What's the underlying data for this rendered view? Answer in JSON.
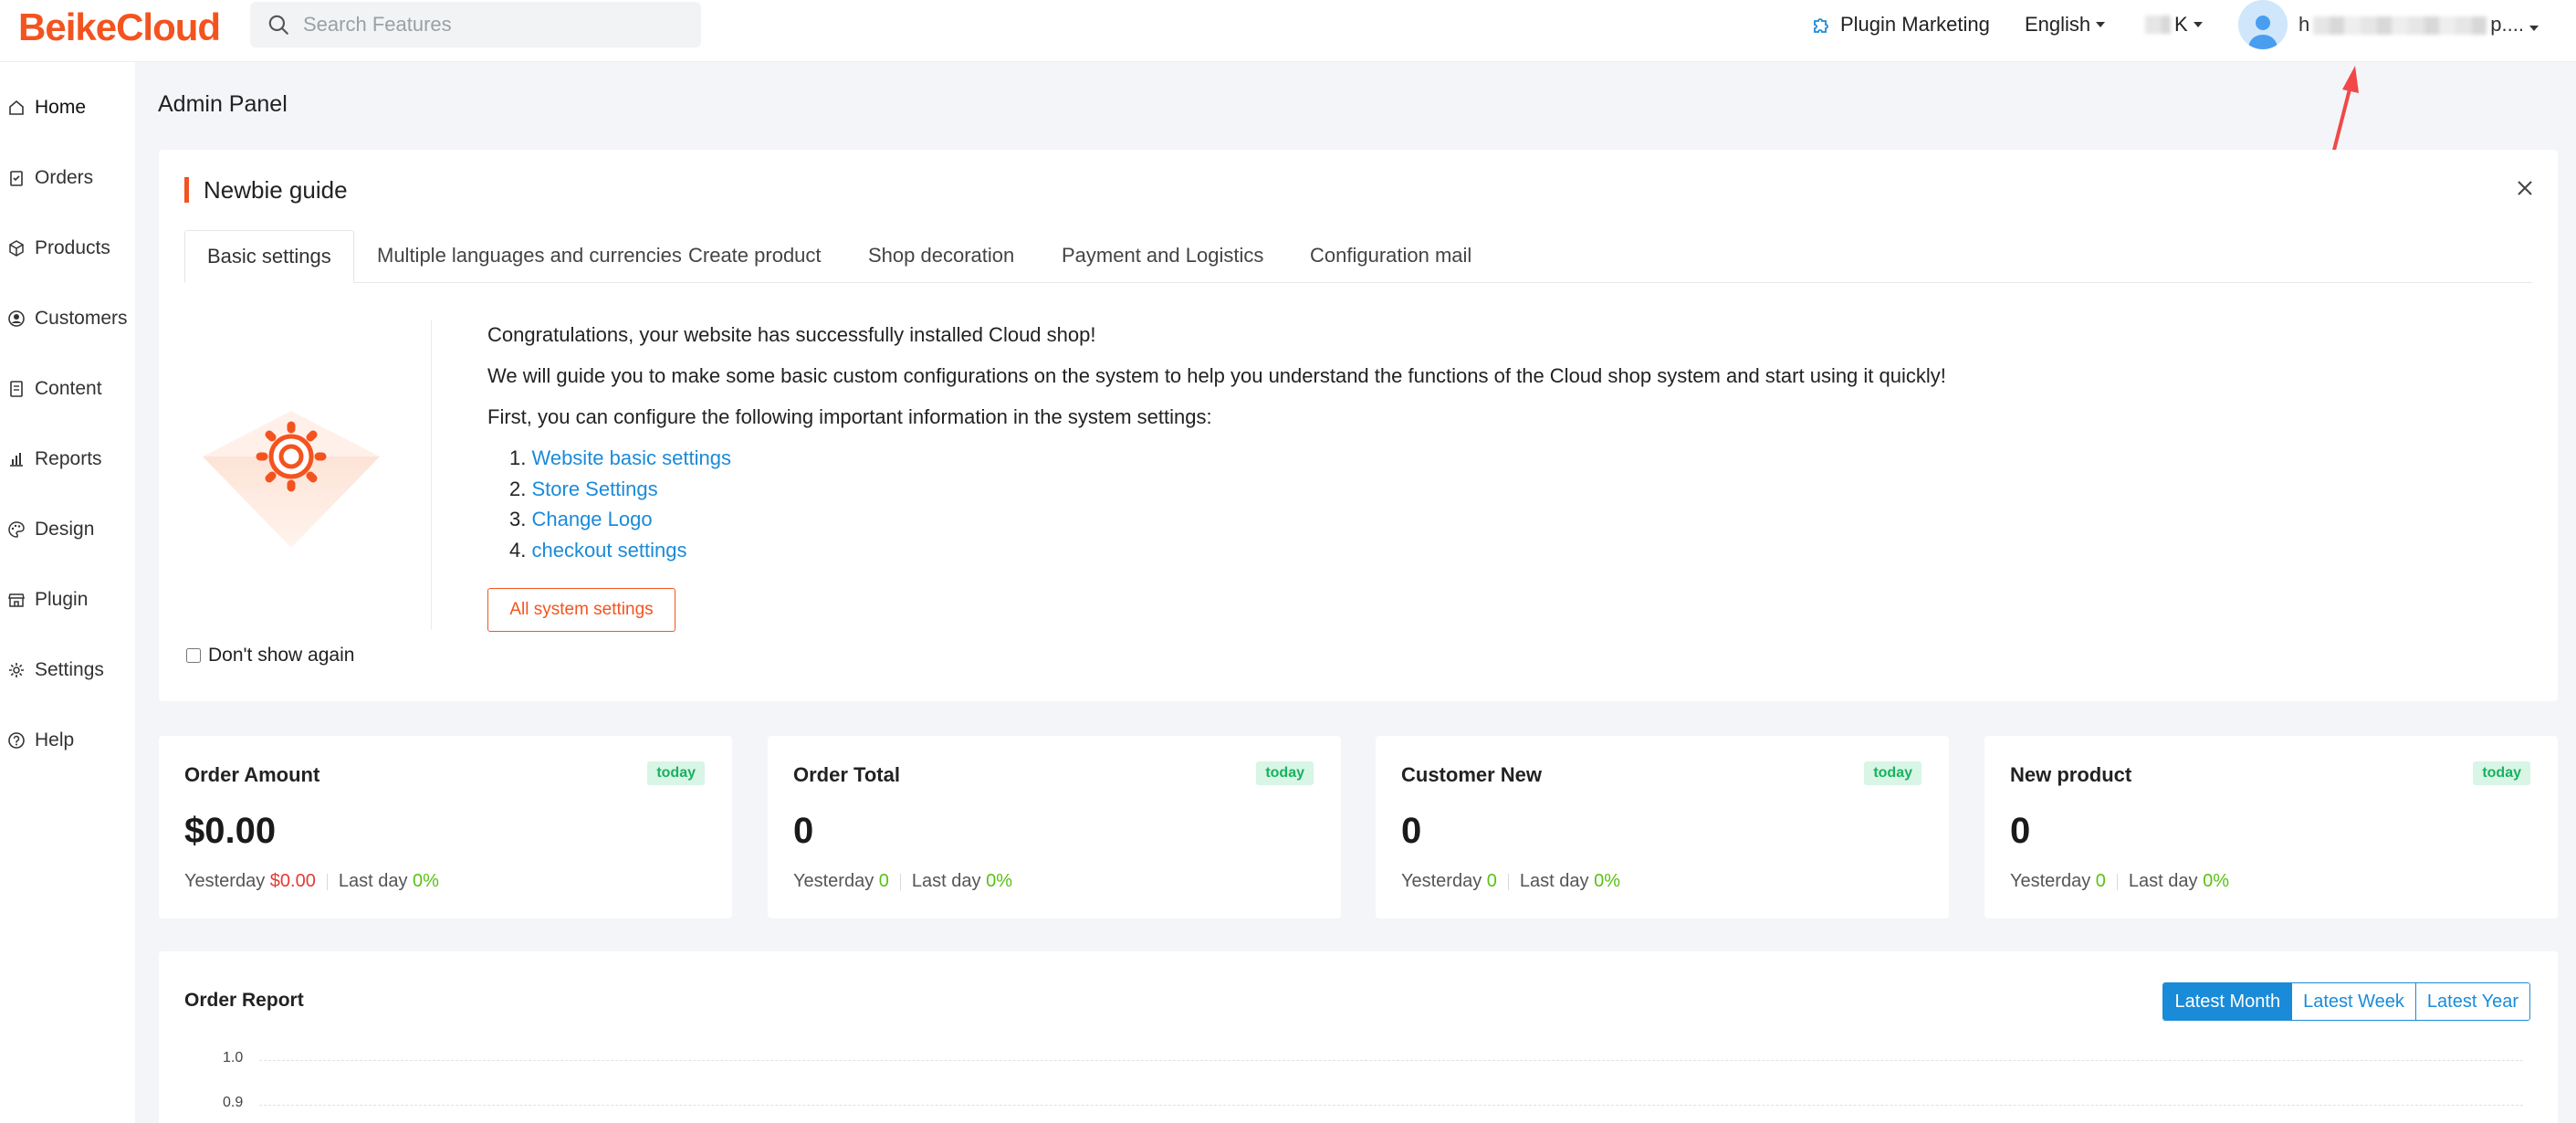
{
  "header": {
    "logo": "BeikeCloud",
    "search_placeholder": "Search Features",
    "plugin_marketing": "Plugin Marketing",
    "language": "English",
    "currency_suffix": "K",
    "user_prefix": "h",
    "user_suffix": "p...."
  },
  "sidebar": {
    "items": [
      {
        "label": "Home",
        "icon": "home-icon"
      },
      {
        "label": "Orders",
        "icon": "clipboard-icon"
      },
      {
        "label": "Products",
        "icon": "box-icon"
      },
      {
        "label": "Customers",
        "icon": "user-circle-icon"
      },
      {
        "label": "Content",
        "icon": "document-icon"
      },
      {
        "label": "Reports",
        "icon": "bar-chart-icon"
      },
      {
        "label": "Design",
        "icon": "palette-icon"
      },
      {
        "label": "Plugin",
        "icon": "store-icon"
      },
      {
        "label": "Settings",
        "icon": "gear-icon"
      },
      {
        "label": "Help",
        "icon": "question-icon"
      }
    ]
  },
  "page": {
    "title": "Admin Panel"
  },
  "guide": {
    "title": "Newbie guide",
    "tabs": [
      "Basic settings",
      "Multiple languages and currencies",
      "Create product",
      "Shop decoration",
      "Payment and Logistics",
      "Configuration mail"
    ],
    "para1": "Congratulations, your website has successfully installed Cloud shop!",
    "para2": "We will guide you to make some basic custom configurations on the system to help you understand the functions of the Cloud shop system and start using it quickly!",
    "para3": "First, you can configure the following important information in the system settings:",
    "links": [
      "Website basic settings",
      "Store Settings",
      "Change Logo",
      "checkout settings"
    ],
    "all_settings_button": "All system settings",
    "dont_show": "Don't show again"
  },
  "stats": [
    {
      "label": "Order Amount",
      "badge": "today",
      "value": "$0.00",
      "yesterday_label": "Yesterday",
      "yesterday_value": "$0.00",
      "lastday_label": "Last day",
      "lastday_value": "0%"
    },
    {
      "label": "Order Total",
      "badge": "today",
      "value": "0",
      "yesterday_label": "Yesterday",
      "yesterday_value": "0",
      "lastday_label": "Last day",
      "lastday_value": "0%"
    },
    {
      "label": "Customer New",
      "badge": "today",
      "value": "0",
      "yesterday_label": "Yesterday",
      "yesterday_value": "0",
      "lastday_label": "Last day",
      "lastday_value": "0%"
    },
    {
      "label": "New product",
      "badge": "today",
      "value": "0",
      "yesterday_label": "Yesterday",
      "yesterday_value": "0",
      "lastday_label": "Last day",
      "lastday_value": "0%"
    }
  ],
  "report": {
    "title": "Order Report",
    "ranges": [
      "Latest Month",
      "Latest Week",
      "Latest Year"
    ],
    "active_range": "Latest Month"
  },
  "chart_data": {
    "type": "line",
    "title": "Order Report",
    "ytick_labels": [
      "1.0",
      "0.9"
    ],
    "ylim": [
      0.9,
      1.0
    ],
    "series": [],
    "grid": true
  },
  "colors": {
    "brand": "#f3541f",
    "link": "#1a8bd8",
    "positive": "#59c113",
    "negative": "#e53935",
    "badge_bg": "#d8f5e5"
  }
}
